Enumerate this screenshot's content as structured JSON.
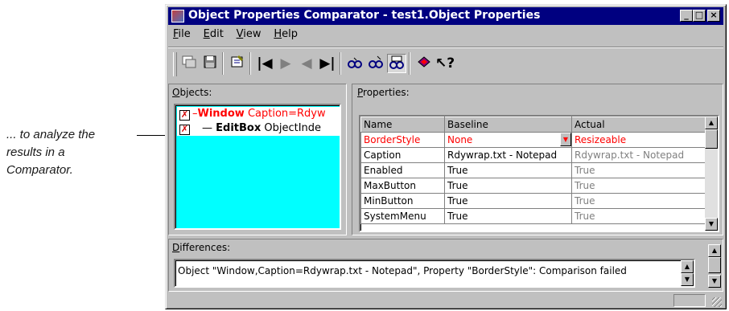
{
  "callout": {
    "line1": "... to analyze the",
    "line2": "results in a",
    "line3": "Comparator."
  },
  "window": {
    "title": "Object Properties Comparator - test1.Object Properties",
    "controls": {
      "minimize": "_",
      "maximize": "□",
      "close": "×"
    }
  },
  "menu": [
    {
      "acc": "F",
      "rest": "ile"
    },
    {
      "acc": "E",
      "rest": "dit"
    },
    {
      "acc": "V",
      "rest": "iew"
    },
    {
      "acc": "H",
      "rest": "elp"
    }
  ],
  "toolbar": {
    "icons": [
      "window-compare-icon",
      "save-icon",
      "properties-icon",
      "first-icon",
      "next-icon",
      "previous-icon",
      "last-icon",
      "compare-icon",
      "compare-all-icon",
      "compare-toggle-icon",
      "book-icon",
      "help-pointer-icon"
    ],
    "glyphs": {
      "first": "|◀",
      "next": "▶",
      "previous": "◀",
      "last": "▶|",
      "help": "↖?"
    }
  },
  "objects_panel": {
    "label_acc": "O",
    "label_rest": "bjects:",
    "rows": [
      {
        "check": "✗",
        "dash": "–",
        "type": "Window",
        "detail": "Caption=Rdyw"
      },
      {
        "check": "✗",
        "dash": "—",
        "type": "EditBox",
        "detail": "ObjectInde"
      }
    ]
  },
  "properties_panel": {
    "label_acc": "P",
    "label_rest": "roperties:",
    "columns": [
      "Name",
      "Baseline",
      "Actual"
    ],
    "rows": [
      {
        "name": "BorderStyle",
        "baseline": "None",
        "actual": "Resizeable"
      },
      {
        "name": "Caption",
        "baseline": "Rdywrap.txt - Notepad",
        "actual": "Rdywrap.txt - Notepad"
      },
      {
        "name": "Enabled",
        "baseline": "True",
        "actual": "True"
      },
      {
        "name": "MaxButton",
        "baseline": "True",
        "actual": "True"
      },
      {
        "name": "MinButton",
        "baseline": "True",
        "actual": "True"
      },
      {
        "name": "SystemMenu",
        "baseline": "True",
        "actual": "True"
      }
    ]
  },
  "differences_panel": {
    "label_acc": "D",
    "label_rest": "ifferences:",
    "text": "Object \"Window,Caption=Rdywrap.txt - Notepad\", Property \"BorderStyle\": Comparison failed"
  },
  "colors": {
    "titlebar": "#000080",
    "face": "#c0c0c0",
    "tree_background": "#00ffff",
    "mismatch": "#ff0000"
  }
}
